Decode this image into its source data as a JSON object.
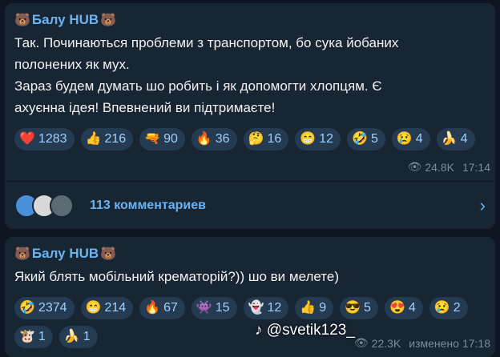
{
  "post1": {
    "author": "Балу HUB",
    "text_line1": "Так. Починаються проблеми з транспортом, бо сука йобаних",
    "text_line2": "полонених як мух.",
    "text_line3": "Зараз будем думать шо робить і як допомогти хлопцям. Є",
    "text_line4": "ахуєнна ідея! Впевнений ви підтримаєте!",
    "reactions": [
      {
        "emoji": "❤️",
        "count": "1283"
      },
      {
        "emoji": "👍",
        "count": "216"
      },
      {
        "emoji": "🔫",
        "count": "90"
      },
      {
        "emoji": "🔥",
        "count": "36"
      },
      {
        "emoji": "🤔",
        "count": "16"
      },
      {
        "emoji": "😁",
        "count": "12"
      },
      {
        "emoji": "🤣",
        "count": "5"
      },
      {
        "emoji": "😢",
        "count": "4"
      },
      {
        "emoji": "🍌",
        "count": "4"
      }
    ],
    "views": "24.8K",
    "time": "17:14",
    "comments_label": "113 комментариев"
  },
  "post2": {
    "author": "Балу HUB",
    "text_line1": "Який блять мобільний крематорій?)) шо ви мелете)",
    "reactions": [
      {
        "emoji": "🤣",
        "count": "2374"
      },
      {
        "emoji": "😁",
        "count": "214"
      },
      {
        "emoji": "🔥",
        "count": "67"
      },
      {
        "emoji": "👾",
        "count": "15"
      },
      {
        "emoji": "👻",
        "count": "12"
      },
      {
        "emoji": "👍",
        "count": "9"
      },
      {
        "emoji": "😎",
        "count": "5"
      },
      {
        "emoji": "😍",
        "count": "4"
      },
      {
        "emoji": "😢",
        "count": "2"
      },
      {
        "emoji": "🐮",
        "count": "1"
      },
      {
        "emoji": "🍌",
        "count": "1"
      }
    ],
    "views": "22.3K",
    "edited": "изменено",
    "time": "17:18"
  },
  "watermark": "@svetik123_",
  "icons": {
    "bear": "bear-icon",
    "eye": "eye-icon",
    "chevron": "chevron-right-icon",
    "tiktok": "tiktok-icon"
  }
}
